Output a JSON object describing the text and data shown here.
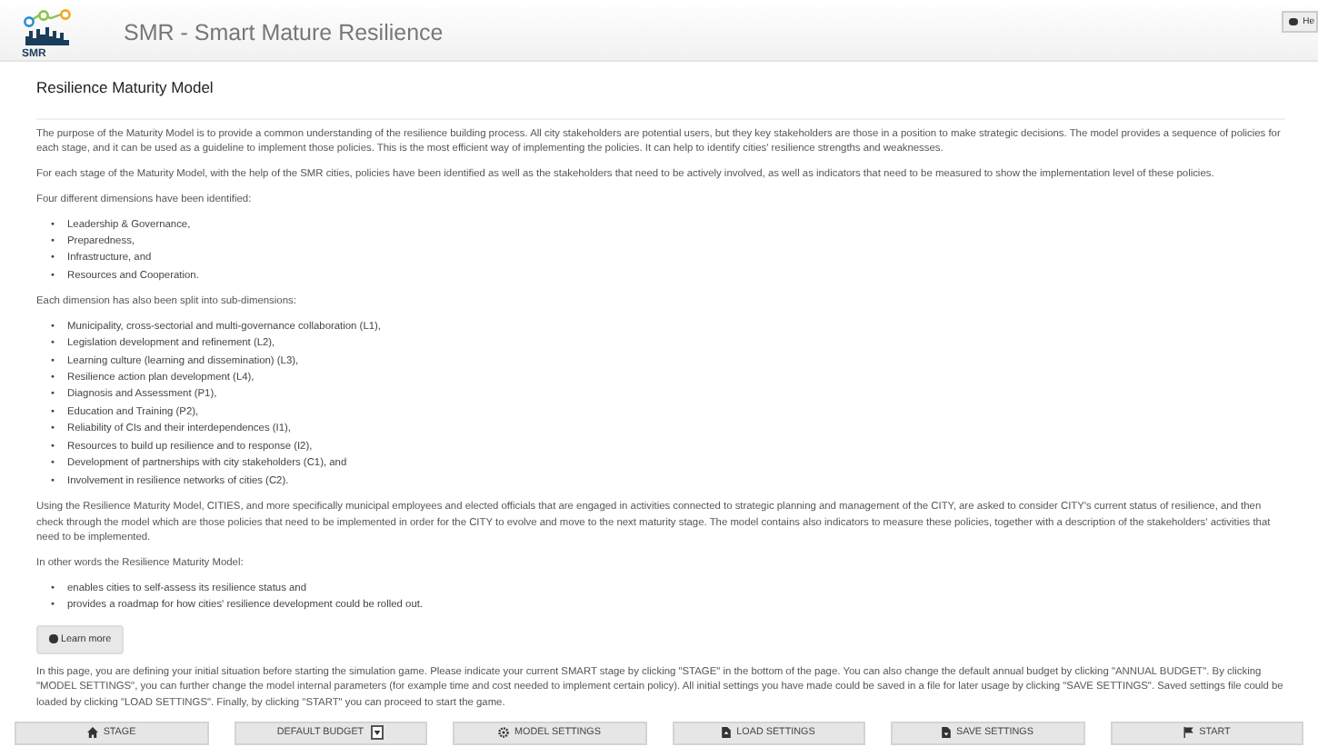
{
  "header": {
    "logo_text": "SMR",
    "title": "SMR - Smart Mature Resilience",
    "help_button": "He"
  },
  "page_title": "Resilience Maturity Model",
  "content": [
    {
      "kind": "para",
      "text": "The purpose of the Maturity Model is to provide a common understanding of the resilience building process. All city stakeholders are potential users, but they key stakeholders are those in a position to make strategic decisions. The model provides a sequence of policies for each stage, and it can be used as a guideline to implement those policies. This is the most efficient way of implementing the policies. It can help to identify cities' resilience strengths and weaknesses."
    },
    {
      "kind": "para",
      "text": "For each stage of the Maturity Model, with the help of the SMR cities, policies have been identified as well as the stakeholders that need to be actively involved, as well as indicators that need to be measured to show the implementation level of these policies."
    },
    {
      "kind": "para",
      "text": "Four different dimensions have been identified:"
    },
    {
      "kind": "list",
      "marker": "•",
      "items": [
        "Leadership & Governance,",
        "Preparedness,",
        "Infrastructure, and",
        "Resources and Cooperation."
      ]
    },
    {
      "kind": "para",
      "text": "Each dimension has also been split into sub-dimensions:"
    },
    {
      "kind": "list",
      "marker": "•",
      "items": [
        "Municipality, cross-sectorial and multi-governance collaboration (L1),",
        "Legislation development and refinement (L2),",
        "Learning culture (learning and dissemination) (L3),",
        "Resilience action plan development (L4),",
        "Diagnosis and Assessment (P1),",
        "Education and Training (P2),",
        "Reliability of CIs and their interdependences (I1),",
        "Resources to build up resilience and to response (I2),",
        "Development of partnerships with city stakeholders (C1), and",
        "Involvement in resilience networks of cities (C2)."
      ]
    },
    {
      "kind": "para",
      "text": "Using the Resilience Maturity Model, CITIES, and more specifically municipal employees and elected officials that are engaged in activities connected to strategic planning and management of the CITY, are asked to consider CITY's current status of resilience, and then check through the model which are those policies that need to be implemented in order for the CITY to evolve and move to the next maturity stage. The model contains also indicators to measure these policies, together with a description of the stakeholders' activities that need to be implemented."
    },
    {
      "kind": "para",
      "text": "In other words the Resilience Maturity Model:"
    },
    {
      "kind": "list",
      "marker": "•",
      "items": [
        "enables cities to self-assess its resilience status and",
        "provides a roadmap for how cities' resilience development could be rolled out."
      ]
    },
    {
      "kind": "button",
      "text": "Learn more"
    },
    {
      "kind": "para",
      "text": "In this page, you are defining your initial situation before starting the simulation game. Please indicate your current SMART stage by clicking \"STAGE\" in the bottom of the page. You can also change the default annual budget by clicking \"ANNUAL BUDGET\". By clicking \"MODEL SETTINGS\", you can further change the model internal parameters (for example time and cost needed to implement certain policy). All initial settings you have made could be saved in a file for later usage by clicking \"SAVE SETTINGS\". Saved settings file could be loaded by clicking \"LOAD SETTINGS\". Finally, by clicking \"START\" you can proceed to start the game."
    }
  ],
  "footer_buttons": [
    {
      "kind": "home",
      "label": "STAGE"
    },
    {
      "kind": "caret",
      "label": "DEFAULT BUDGET"
    },
    {
      "kind": "gear",
      "label": "MODEL SETTINGS"
    },
    {
      "kind": "upload",
      "label": "LOAD SETTINGS"
    },
    {
      "kind": "download",
      "label": "SAVE SETTINGS"
    },
    {
      "kind": "flag",
      "label": "START"
    }
  ]
}
